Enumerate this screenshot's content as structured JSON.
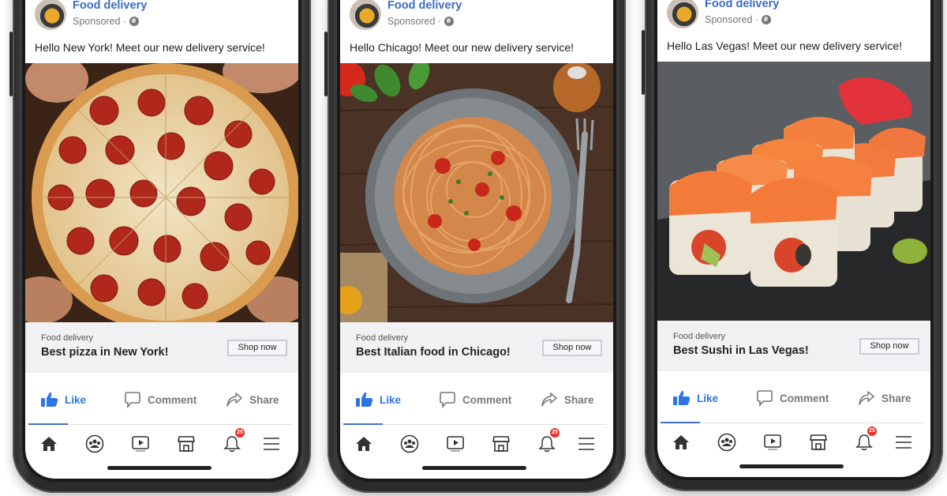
{
  "colors": {
    "brand_blue": "#3b6cc2",
    "like_blue": "#2d74e6",
    "link_bar_bg": "#f0f1f3",
    "badge_red": "#e9332b",
    "phone_frame": "#2b2b2b"
  },
  "ads": [
    {
      "page_name": "Food delivery",
      "sponsored": "Sponsored ·",
      "caption": "Hello New York! Meet our new delivery service!",
      "image": "pizza-photo",
      "link_domain": "Food delivery",
      "link_title": "Best pizza in New York!",
      "cta": "Shop now",
      "actions": {
        "like": "Like",
        "comment": "Comment",
        "share": "Share"
      },
      "notification_count": "25"
    },
    {
      "page_name": "Food delivery",
      "sponsored": "Sponsored ·",
      "caption": "Hello Chicago! Meet our new delivery service!",
      "image": "spaghetti-photo",
      "link_domain": "Food delivery",
      "link_title": "Best Italian food in Chicago!",
      "cta": "Shop now",
      "actions": {
        "like": "Like",
        "comment": "Comment",
        "share": "Share"
      },
      "notification_count": "25"
    },
    {
      "page_name": "Food delivery",
      "sponsored": "Sponsored ·",
      "caption": "Hello Las Vegas! Meet our new delivery service!",
      "image": "sushi-photo",
      "link_domain": "Food delivery",
      "link_title": "Best Sushi in Las Vegas!",
      "cta": "Shop now",
      "actions": {
        "like": "Like",
        "comment": "Comment",
        "share": "Share"
      },
      "notification_count": "25"
    }
  ],
  "bottom_nav": [
    "home-icon",
    "groups-icon",
    "watch-icon",
    "marketplace-icon",
    "notifications-icon",
    "menu-icon"
  ]
}
